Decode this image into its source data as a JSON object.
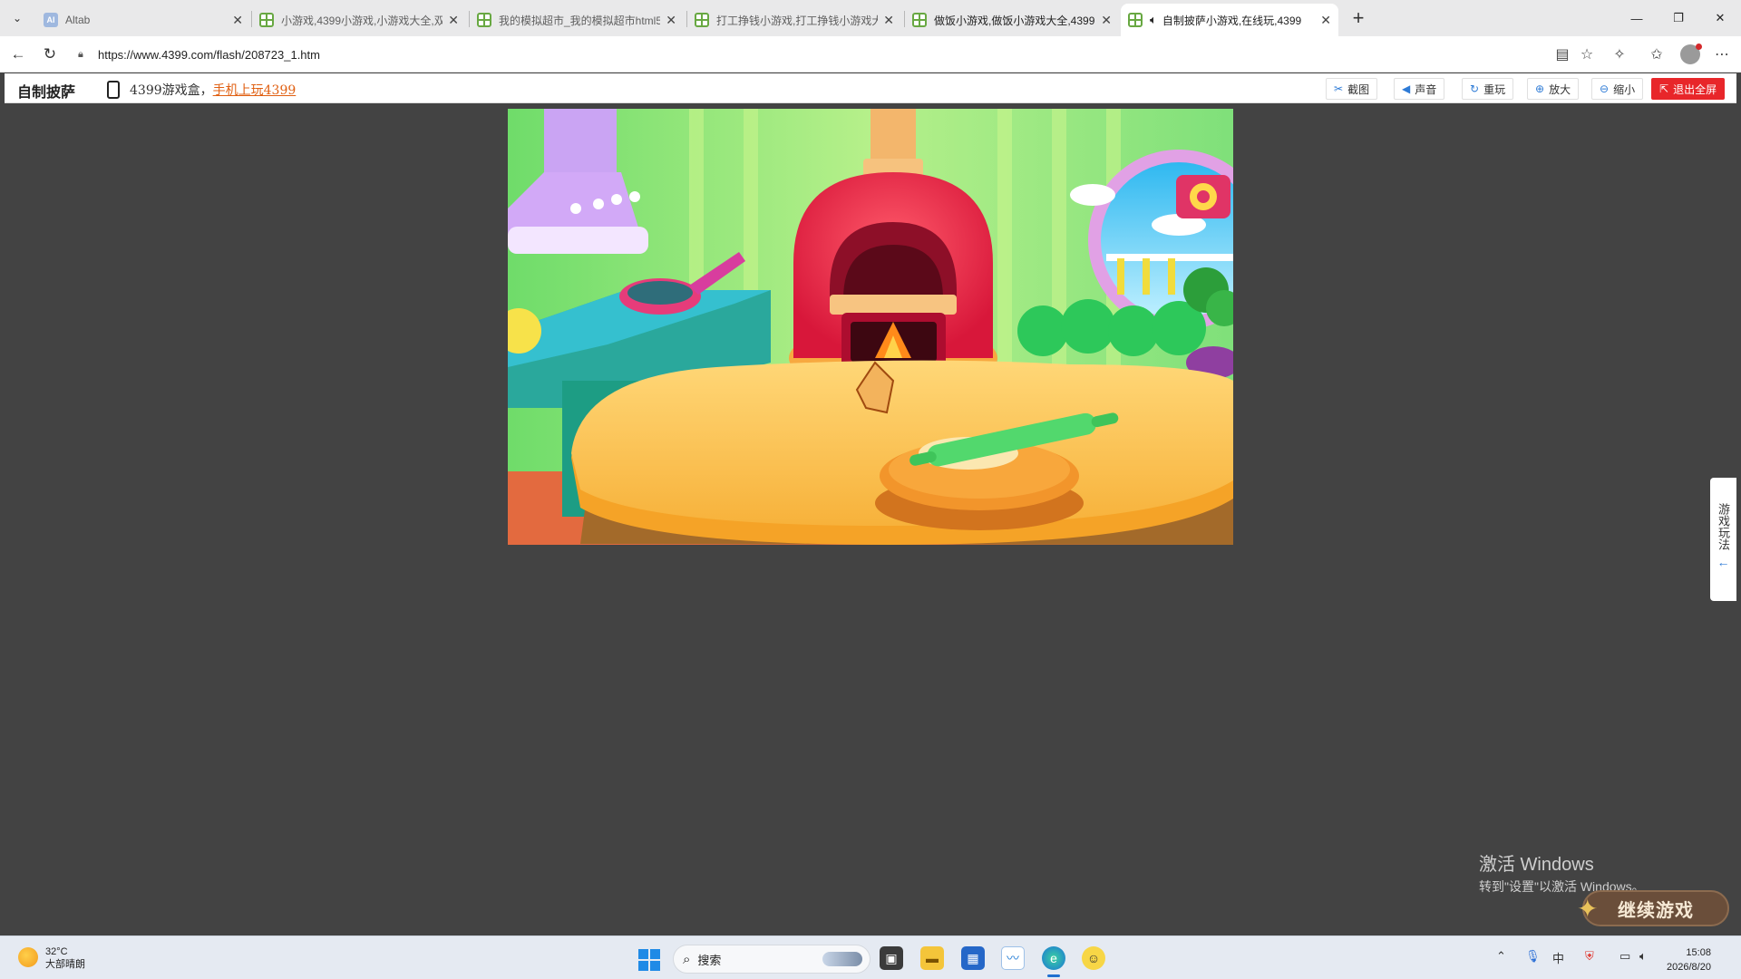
{
  "browser": {
    "tabs": [
      {
        "title": "Altab",
        "favicon": "altab-icon",
        "active": false
      },
      {
        "title": "小游戏,4399小游戏,小游戏大全,双",
        "favicon": "4399-icon",
        "active": false
      },
      {
        "title": "我的模拟超市_我的模拟超市html5",
        "favicon": "4399-icon",
        "active": false
      },
      {
        "title": "打工挣钱小游戏,打工挣钱小游戏大",
        "favicon": "4399-icon",
        "active": false
      },
      {
        "title": "做饭小游戏,做饭小游戏大全,4399",
        "favicon": "4399-icon",
        "active": false
      },
      {
        "title": "自制披萨小游戏,在线玩,4399",
        "favicon": "4399-icon",
        "active": true,
        "audio": true
      }
    ],
    "url": "https://www.4399.com/flash/208723_1.htm"
  },
  "site": {
    "title": "自制披萨",
    "promo_text": "4399游戏盒，",
    "promo_link": "手机上玩4399",
    "buttons": [
      {
        "name": "screenshot-button",
        "icon": "scissors-icon",
        "label": "截图"
      },
      {
        "name": "sound-button",
        "icon": "speaker-icon",
        "label": "声音"
      },
      {
        "name": "replay-button",
        "icon": "refresh-icon",
        "label": "重玩"
      },
      {
        "name": "zoom-in-button",
        "icon": "zoom-in-icon",
        "label": "放大"
      },
      {
        "name": "zoom-out-button",
        "icon": "zoom-out-icon",
        "label": "缩小"
      },
      {
        "name": "exit-fullscreen-button",
        "icon": "exit-icon",
        "label": "退出全屏"
      }
    ],
    "side_tab": "游戏玩法"
  },
  "overlay": {
    "activate_title": "激活 Windows",
    "activate_sub": "转到\"设置\"以激活 Windows。",
    "continue_label": "继续游戏"
  },
  "taskbar": {
    "weather_temp": "32°C",
    "weather_desc": "大部晴朗",
    "search_label": "搜索",
    "time": "15:08",
    "date": "2026/8/20"
  },
  "colors": {
    "accent_red": "#e8262a",
    "link_orange": "#e05f11",
    "content_bg": "#434343"
  }
}
